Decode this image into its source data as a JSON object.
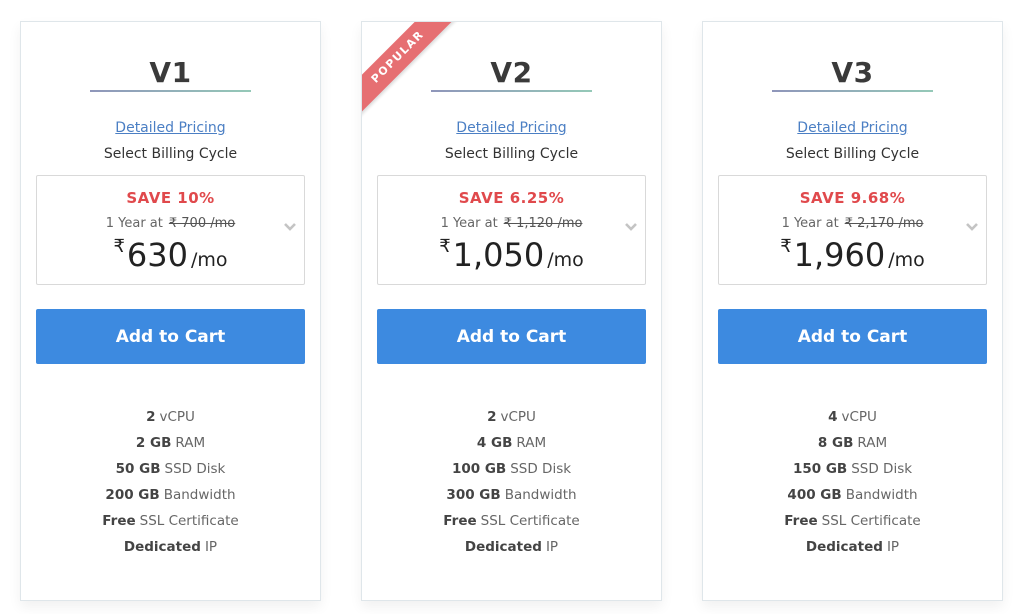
{
  "accent_color": "#3d8ae0",
  "save_color": "#e0494c",
  "ribbon_color": "#e66f72",
  "plans": [
    {
      "name": "V1",
      "ribbon": null,
      "detailed_pricing_label": "Detailed Pricing",
      "billing_label": "Select Billing Cycle",
      "save_text": "SAVE 10%",
      "cycle_prefix": "1 Year at",
      "original_price": "₹ 700 /mo",
      "currency": "₹",
      "price": "630",
      "per": "/mo",
      "cart_label": "Add to Cart",
      "features": [
        {
          "bold": "2",
          "text": "vCPU"
        },
        {
          "bold": "2 GB",
          "text": "RAM"
        },
        {
          "bold": "50 GB",
          "text": "SSD Disk"
        },
        {
          "bold": "200 GB",
          "text": "Bandwidth"
        },
        {
          "bold": "Free",
          "text": "SSL Certificate"
        },
        {
          "bold": "Dedicated",
          "text": "IP"
        }
      ]
    },
    {
      "name": "V2",
      "ribbon": "POPULAR",
      "detailed_pricing_label": "Detailed Pricing",
      "billing_label": "Select Billing Cycle",
      "save_text": "SAVE 6.25%",
      "cycle_prefix": "1 Year at",
      "original_price": "₹ 1,120 /mo",
      "currency": "₹",
      "price": "1,050",
      "per": "/mo",
      "cart_label": "Add to Cart",
      "features": [
        {
          "bold": "2",
          "text": "vCPU"
        },
        {
          "bold": "4 GB",
          "text": "RAM"
        },
        {
          "bold": "100 GB",
          "text": "SSD Disk"
        },
        {
          "bold": "300 GB",
          "text": "Bandwidth"
        },
        {
          "bold": "Free",
          "text": "SSL Certificate"
        },
        {
          "bold": "Dedicated",
          "text": "IP"
        }
      ]
    },
    {
      "name": "V3",
      "ribbon": null,
      "detailed_pricing_label": "Detailed Pricing",
      "billing_label": "Select Billing Cycle",
      "save_text": "SAVE 9.68%",
      "cycle_prefix": "1 Year at",
      "original_price": "₹ 2,170 /mo",
      "currency": "₹",
      "price": "1,960",
      "per": "/mo",
      "cart_label": "Add to Cart",
      "features": [
        {
          "bold": "4",
          "text": "vCPU"
        },
        {
          "bold": "8 GB",
          "text": "RAM"
        },
        {
          "bold": "150 GB",
          "text": "SSD Disk"
        },
        {
          "bold": "400 GB",
          "text": "Bandwidth"
        },
        {
          "bold": "Free",
          "text": "SSL Certificate"
        },
        {
          "bold": "Dedicated",
          "text": "IP"
        }
      ]
    }
  ]
}
